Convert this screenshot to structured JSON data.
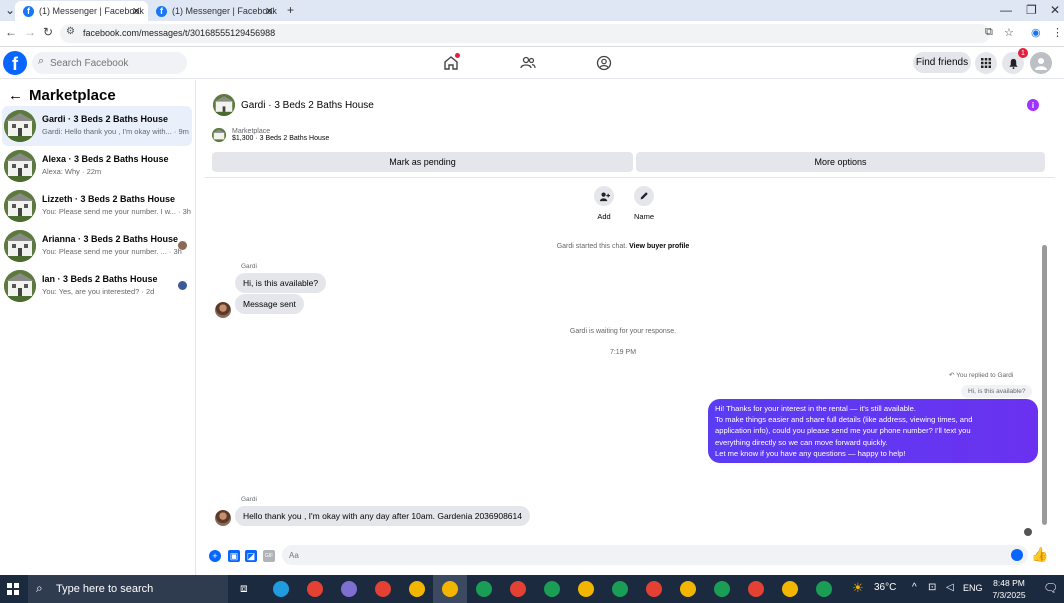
{
  "browser": {
    "tabs": [
      {
        "title": "(1) Messenger | Facebook",
        "active": true
      },
      {
        "title": "(1) Messenger | Facebook",
        "active": false
      }
    ],
    "url": "facebook.com/messages/t/30168555129456988"
  },
  "fb_header": {
    "search_placeholder": "Search Facebook",
    "find_friends": "Find friends",
    "notification_count": "1"
  },
  "sidebar": {
    "title": "Marketplace",
    "conversations": [
      {
        "name": "Gardi · 3 Beds 2 Baths House",
        "snippet": "Gardi: Hello thank you , I'm okay with... · 9m",
        "active": true
      },
      {
        "name": "Alexa · 3 Beds 2 Baths House",
        "snippet": "Alexa: Why · 22m",
        "active": false
      },
      {
        "name": "Lizzeth · 3 Beds 2 Baths House",
        "snippet": "You: Please send me your number. I w... · 3h",
        "active": false
      },
      {
        "name": "Arianna · 3 Beds 2 Baths House",
        "snippet": "You: Please send me your number. ... · 3h",
        "active": false
      },
      {
        "name": "Ian · 3 Beds 2 Baths House",
        "snippet": "You: Yes, are you interested? · 2d",
        "active": false
      }
    ]
  },
  "chat": {
    "title": "Gardi · 3 Beds 2 Baths House",
    "listing_label": "Marketplace",
    "listing_detail": "$1,300 · 3 Beds 2 Baths House",
    "mark_pending": "Mark as pending",
    "more_options": "More options",
    "quick_actions": [
      {
        "label": "Add"
      },
      {
        "label": "Name"
      }
    ],
    "started_text": "Gardi started this chat.",
    "view_profile": "View buyer profile",
    "sender_name": "Gardi",
    "msg1": "Hi, is this available?",
    "msg2": "Message sent",
    "waiting_text": "Gardi is waiting for your response.",
    "timestamp": "7:19 PM",
    "replied_label": "You replied to Gardi",
    "quoted_text": "Hi, is this available?",
    "out_lines": [
      "Hi! Thanks for your interest in the rental — it's still available.",
      "To make things easier and share full details (like address, viewing times, and",
      "application info), could you please send me your phone number? I'll text you",
      "everything directly so we can move forward quickly.",
      "Let me know if you have any questions — happy to help!"
    ],
    "last_msg": "Hello thank you , I'm okay with any day after 10am. Gardenia 2036908614",
    "composer_placeholder": "Aa"
  },
  "taskbar": {
    "search_text": "Type here to search",
    "temperature": "36°C",
    "language": "ENG",
    "time": "8:48 PM",
    "date": "7/3/2025"
  }
}
